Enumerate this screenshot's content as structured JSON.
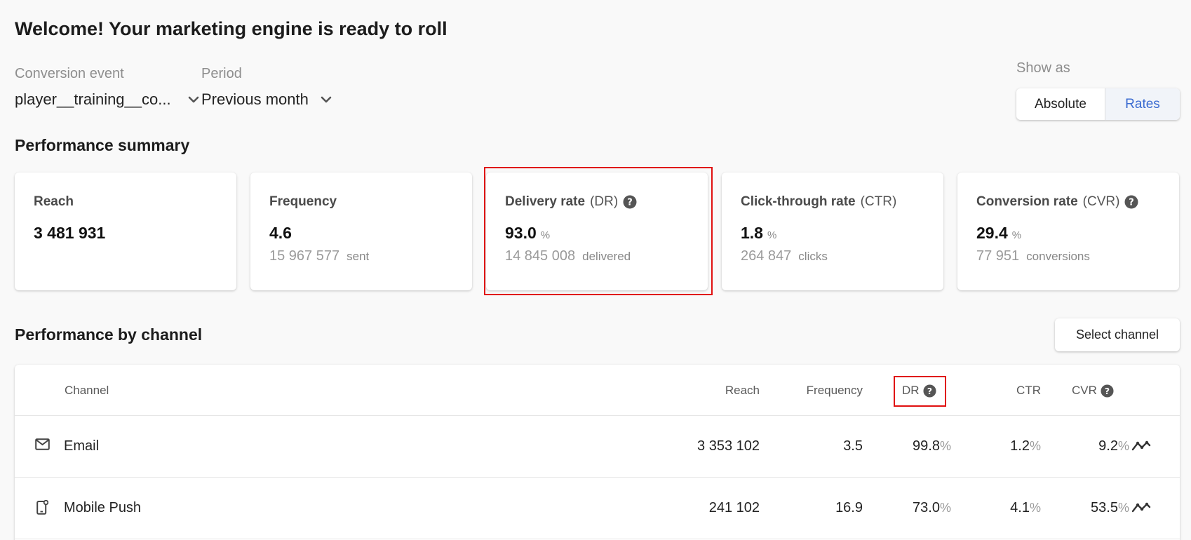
{
  "page": {
    "title": "Welcome! Your marketing engine is ready to roll"
  },
  "filters": {
    "conversion_event": {
      "label": "Conversion event",
      "value": "player__training__co..."
    },
    "period": {
      "label": "Period",
      "value": "Previous month"
    }
  },
  "show_as": {
    "label": "Show as",
    "options": [
      "Absolute",
      "Rates"
    ],
    "selected": "Rates"
  },
  "summary": {
    "title": "Performance summary",
    "cards": [
      {
        "title": "Reach",
        "abbr": "",
        "value": "3 481 931",
        "unit": "",
        "sub_value": "",
        "sub_label": ""
      },
      {
        "title": "Frequency",
        "abbr": "",
        "value": "4.6",
        "unit": "",
        "sub_value": "15 967 577",
        "sub_label": "sent"
      },
      {
        "title": "Delivery rate",
        "abbr": "(DR)",
        "value": "93.0",
        "unit": "%",
        "sub_value": "14 845 008",
        "sub_label": "delivered"
      },
      {
        "title": "Click-through rate",
        "abbr": "(CTR)",
        "value": "1.8",
        "unit": "%",
        "sub_value": "264 847",
        "sub_label": "clicks"
      },
      {
        "title": "Conversion rate",
        "abbr": "(CVR)",
        "value": "29.4",
        "unit": "%",
        "sub_value": "77 951",
        "sub_label": "conversions"
      }
    ]
  },
  "channels": {
    "title": "Performance by channel",
    "select_button": "Select channel",
    "columns": {
      "channel": "Channel",
      "reach": "Reach",
      "frequency": "Frequency",
      "dr": "DR",
      "ctr": "CTR",
      "cvr": "CVR"
    },
    "pct_symbol": "%",
    "rows": [
      {
        "icon": "email-icon",
        "name": "Email",
        "reach": "3 353 102",
        "frequency": "3.5",
        "dr": "99.8",
        "ctr": "1.2",
        "cvr": "9.2"
      },
      {
        "icon": "mobile-push-icon",
        "name": "Mobile Push",
        "reach": "241 102",
        "frequency": "16.9",
        "dr": "73.0",
        "ctr": "4.1",
        "cvr": "53.5"
      }
    ]
  },
  "colors": {
    "accent": "#3b6bd1",
    "highlight": "#e01010"
  }
}
